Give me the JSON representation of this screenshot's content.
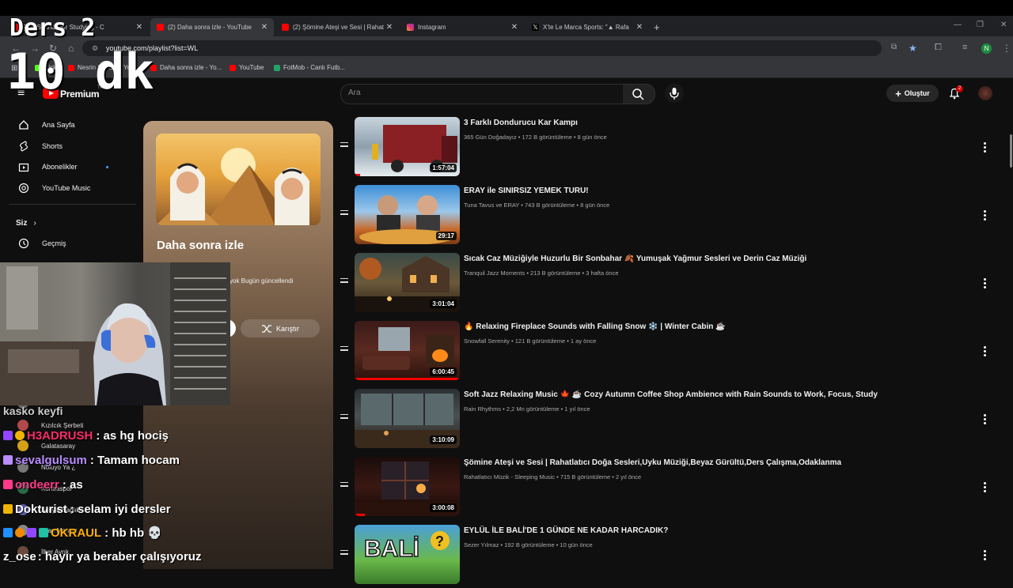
{
  "browser": {
    "tabs": [
      {
        "title": "Rain Sounds for Studying - C",
        "favicon_color": "#ff0000"
      },
      {
        "title": "(2) Daha sonra izle - YouTube",
        "favicon_color": "#ff0000"
      },
      {
        "title": "(2) Şömine Ateşi ve Sesi | Rahat",
        "favicon_color": "#ff0000"
      },
      {
        "title": "Instagram",
        "favicon_color": "#e1306c"
      },
      {
        "title": "X'te Le Marca Sports: \"▲ Rafa",
        "favicon_color": "#000000"
      }
    ],
    "new_tab": "+",
    "url": "youtube.com/playlist?list=WL",
    "bookmarks": [
      {
        "label": "Kick",
        "color": "#53fc18"
      },
      {
        "label": "Nesrin Stream - Yo...",
        "color": "#ff0000"
      },
      {
        "label": "Daha sonra izle - Yo...",
        "color": "#ff0000"
      },
      {
        "label": "YouTube",
        "color": "#ff0000"
      },
      {
        "label": "FotMob - Canlı Futb...",
        "color": "#21a36b"
      }
    ],
    "profile_initial": "N"
  },
  "overlay": {
    "line1": "Ders 2",
    "line2": "10 dk"
  },
  "youtube": {
    "logo": "Premium",
    "logo_sup": "TR",
    "search_placeholder": "Ara",
    "create_label": "Oluştur",
    "notification_count": "2",
    "sidebar": {
      "items": [
        {
          "label": "Ana Sayfa",
          "icon": "home-icon"
        },
        {
          "label": "Shorts",
          "icon": "shorts-icon"
        },
        {
          "label": "Abonelikler",
          "icon": "subscriptions-icon"
        },
        {
          "label": "YouTube Music",
          "icon": "music-icon"
        }
      ],
      "you_label": "Siz",
      "history_label": "Geçmiş",
      "subscriptions": [
        {
          "name": "Abonelikler",
          "color": "#666666"
        },
        {
          "name": "Kızılcık Şerbeti",
          "color": "#b04a4a"
        },
        {
          "name": "Galatasaray",
          "color": "#d4a017"
        },
        {
          "name": "Noluyo Ya ¿",
          "color": "#777777"
        },
        {
          "name": "Kontraspor",
          "color": "#2a6a4a"
        },
        {
          "name": "Sosyal Sağlık",
          "color": "#5a5aaa"
        },
        {
          "name": "Ilhan Mansız",
          "color": "#888888"
        },
        {
          "name": "İlker Ayrık",
          "color": "#6a4a3a"
        }
      ]
    },
    "playlist": {
      "title": "Daha sonra izle",
      "meta": "yok  Bugün güncellendi",
      "shuffle_label": "Karıştır"
    },
    "videos": [
      {
        "title": "3 Farklı Dondurucu Kar Kampı",
        "meta": "365 Gün Doğadayız • 172 B görüntüleme • 8 gün önce",
        "duration": "1:57:04",
        "progress": 0.05
      },
      {
        "title": "ERAY ile SINIRSIZ YEMEK TURU!",
        "meta": "Tuna Tavus ve ERAY • 743 B görüntüleme • 8 gün önce",
        "duration": "29:17",
        "progress": 0
      },
      {
        "title": "Sıcak Caz Müziğiyle Huzurlu Bir Sonbahar 🍂 Yumuşak Yağmur Sesleri ve Derin Caz Müziği",
        "meta": "Tranquil Jazz Moments • 213 B görüntüleme • 3 hafta önce",
        "duration": "3:01:04",
        "progress": 0
      },
      {
        "title": "🔥 Relaxing Fireplace Sounds with Falling Snow ❄️ | Winter Cabin ☕",
        "meta": "Snowfall Serenity • 121 B görüntüleme • 1 ay önce",
        "duration": "6:00:45",
        "progress": 1.0
      },
      {
        "title": "Soft Jazz Relaxing Music 🍁 ☕ Cozy Autumn Coffee Shop Ambience with Rain Sounds to Work, Focus, Study",
        "meta": "Rain Rhythms • 2,2 Mn görüntüleme • 1 yıl önce",
        "duration": "3:10:09",
        "progress": 0
      },
      {
        "title": "Şömine Ateşi ve Sesi | Rahatlatıcı Doğa Sesleri,Uyku Müziği,Beyaz Gürültü,Ders Çalışma,Odaklanma",
        "meta": "Rahatlatıcı Müzik - Sleeping Music • 715 B görüntüleme • 2 yıl önce",
        "duration": "3:00:08",
        "progress": 0.1
      },
      {
        "title": "EYLÜL İLE BALİ'DE 1 GÜNDE NE KADAR HARCADIK?",
        "meta": "Sezer Yılmaz • 192 B görüntüleme • 10 gün önce",
        "duration": "",
        "progress": 0
      }
    ]
  },
  "chat": [
    {
      "user": "",
      "text": "kasko keyfi",
      "color": "#cccccc"
    },
    {
      "user": "H3ADRUSH",
      "text": ": as hg hociş",
      "color": "#ff2a6a"
    },
    {
      "user": "sevalgulsum",
      "text": ": Tamam hocam",
      "color": "#b98cff"
    },
    {
      "user": "ondeerr",
      "text": ": as",
      "color": "#ff3a8a"
    },
    {
      "user": "Dokturist",
      "text": ": selam iyi dersler",
      "color": "#ffffff"
    },
    {
      "user": "OKRAUL",
      "text": ": hb hb 💀",
      "color": "#ffb000"
    },
    {
      "user": "z_ose",
      "text": ": hayır ya beraber çalışıyoruz",
      "color": "#ffffff"
    }
  ]
}
